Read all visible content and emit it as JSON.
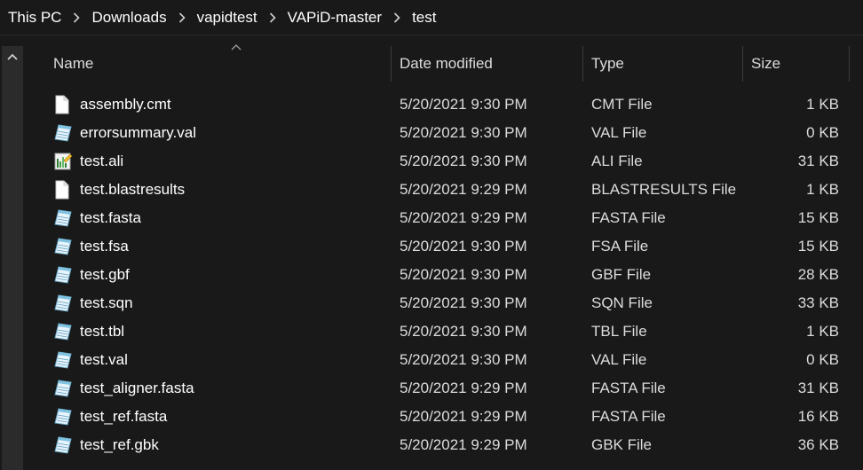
{
  "breadcrumb": {
    "items": [
      "This PC",
      "Downloads",
      "vapidtest",
      "VAPiD-master",
      "test"
    ]
  },
  "columns": {
    "name": "Name",
    "date": "Date modified",
    "type": "Type",
    "size": "Size"
  },
  "files": [
    {
      "name": "assembly.cmt",
      "date": "5/20/2021 9:30 PM",
      "type": "CMT File",
      "size": "1 KB",
      "icon": "blank-file-icon"
    },
    {
      "name": "errorsummary.val",
      "date": "5/20/2021 9:30 PM",
      "type": "VAL File",
      "size": "0 KB",
      "icon": "text-file-icon"
    },
    {
      "name": "test.ali",
      "date": "5/20/2021 9:30 PM",
      "type": "ALI File",
      "size": "31 KB",
      "icon": "ali-file-icon"
    },
    {
      "name": "test.blastresults",
      "date": "5/20/2021 9:29 PM",
      "type": "BLASTRESULTS File",
      "size": "1 KB",
      "icon": "blank-file-icon"
    },
    {
      "name": "test.fasta",
      "date": "5/20/2021 9:29 PM",
      "type": "FASTA File",
      "size": "15 KB",
      "icon": "text-file-icon"
    },
    {
      "name": "test.fsa",
      "date": "5/20/2021 9:30 PM",
      "type": "FSA File",
      "size": "15 KB",
      "icon": "text-file-icon"
    },
    {
      "name": "test.gbf",
      "date": "5/20/2021 9:30 PM",
      "type": "GBF File",
      "size": "28 KB",
      "icon": "text-file-icon"
    },
    {
      "name": "test.sqn",
      "date": "5/20/2021 9:30 PM",
      "type": "SQN File",
      "size": "33 KB",
      "icon": "text-file-icon"
    },
    {
      "name": "test.tbl",
      "date": "5/20/2021 9:30 PM",
      "type": "TBL File",
      "size": "1 KB",
      "icon": "text-file-icon"
    },
    {
      "name": "test.val",
      "date": "5/20/2021 9:30 PM",
      "type": "VAL File",
      "size": "0 KB",
      "icon": "text-file-icon"
    },
    {
      "name": "test_aligner.fasta",
      "date": "5/20/2021 9:29 PM",
      "type": "FASTA File",
      "size": "31 KB",
      "icon": "text-file-icon"
    },
    {
      "name": "test_ref.fasta",
      "date": "5/20/2021 9:29 PM",
      "type": "FASTA File",
      "size": "16 KB",
      "icon": "text-file-icon"
    },
    {
      "name": "test_ref.gbk",
      "date": "5/20/2021 9:29 PM",
      "type": "GBK File",
      "size": "36 KB",
      "icon": "text-file-icon"
    }
  ],
  "colors": {
    "background": "#191919",
    "text": "#ffffff",
    "secondary_text": "#dcdcdc",
    "divider": "#3a3a3a"
  }
}
